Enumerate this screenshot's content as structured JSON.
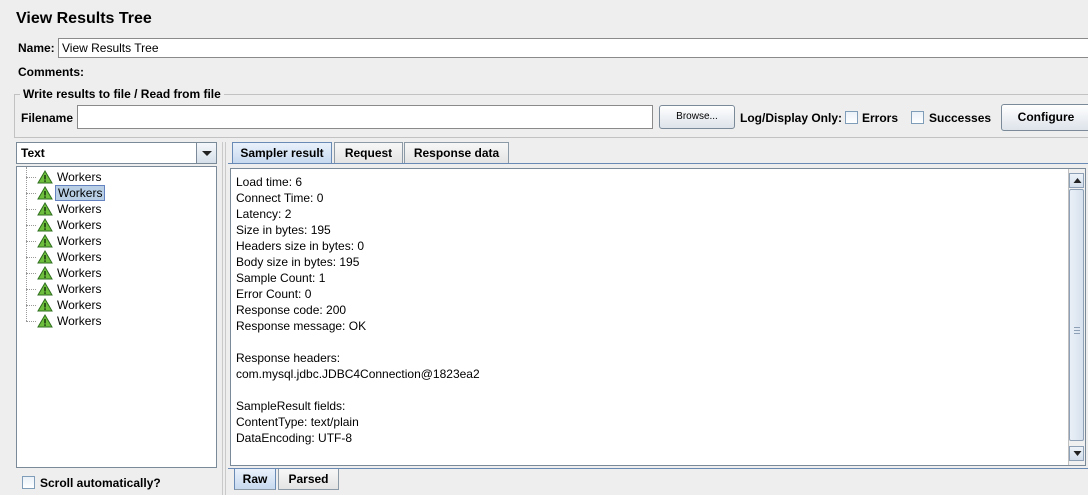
{
  "title": "View Results Tree",
  "name_label": "Name:",
  "name_value": "View Results Tree",
  "comments_label": "Comments:",
  "file_group": {
    "legend": "Write results to file / Read from file",
    "filename_label": "Filename",
    "filename_value": "",
    "browse_label": "Browse...",
    "log_display_label": "Log/Display Only:",
    "errors_label": "Errors",
    "successes_label": "Successes",
    "configure_label": "Configure"
  },
  "renderer_select": {
    "selected": "Text"
  },
  "tree": {
    "items": [
      {
        "label": "Workers",
        "selected": false
      },
      {
        "label": "Workers",
        "selected": true
      },
      {
        "label": "Workers",
        "selected": false
      },
      {
        "label": "Workers",
        "selected": false
      },
      {
        "label": "Workers",
        "selected": false
      },
      {
        "label": "Workers",
        "selected": false
      },
      {
        "label": "Workers",
        "selected": false
      },
      {
        "label": "Workers",
        "selected": false
      },
      {
        "label": "Workers",
        "selected": false
      },
      {
        "label": "Workers",
        "selected": false
      }
    ]
  },
  "scroll_auto_label": "Scroll automatically?",
  "tabs": [
    "Sampler result",
    "Request",
    "Response data"
  ],
  "active_tab": "Sampler result",
  "result_lines": [
    "Load time: 6",
    "Connect Time: 0",
    "Latency: 2",
    "Size in bytes: 195",
    "Headers size in bytes: 0",
    "Body size in bytes: 195",
    "Sample Count: 1",
    "Error Count: 0",
    "Response code: 200",
    "Response message: OK",
    "",
    "Response headers:",
    "com.mysql.jdbc.JDBC4Connection@1823ea2",
    "",
    "SampleResult fields:",
    "ContentType: text/plain",
    "DataEncoding: UTF-8"
  ],
  "bottom_tabs": [
    "Raw",
    "Parsed"
  ],
  "bottom_active_tab": "Raw",
  "colors": {
    "background": "#eeeeee",
    "selection": "#b8cfe5",
    "tab_active": "#c7d9ef"
  },
  "icons": {
    "tree_item": "warning-triangle-icon",
    "dropdown": "chevron-down-icon"
  }
}
